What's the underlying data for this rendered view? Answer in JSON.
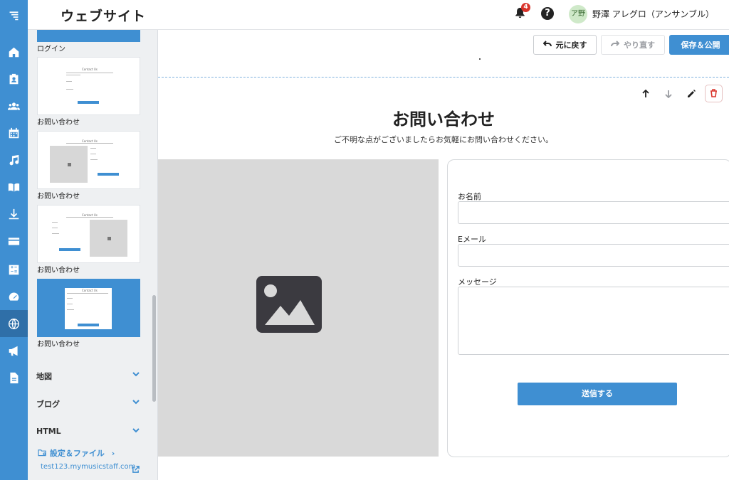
{
  "header": {
    "title": "ウェブサイト",
    "notification_count": "4",
    "help_label": "?",
    "user_initials": "ア野",
    "user_name": "野澤 アレグロ（アンサンブル）"
  },
  "rail": {
    "items": [
      {
        "icon": "logo-icon"
      },
      {
        "icon": "home-icon"
      },
      {
        "icon": "contact-card-icon"
      },
      {
        "icon": "people-icon"
      },
      {
        "icon": "calendar-icon"
      },
      {
        "icon": "music-note-icon"
      },
      {
        "icon": "book-icon"
      },
      {
        "icon": "download-icon"
      },
      {
        "icon": "credit-card-icon"
      },
      {
        "icon": "calculator-icon"
      },
      {
        "icon": "dashboard-icon"
      },
      {
        "icon": "globe-icon",
        "active": true
      },
      {
        "icon": "megaphone-icon"
      },
      {
        "icon": "document-icon"
      }
    ]
  },
  "sidebar": {
    "top_label": "ログイン",
    "thumbnails": [
      {
        "title": "Contact Us",
        "label": "お問い合わせ"
      },
      {
        "title": "Contact Us",
        "label": "お問い合わせ"
      },
      {
        "title": "Contact Us",
        "label": "お問い合わせ"
      },
      {
        "title": "Contact Us",
        "label": "お問い合わせ"
      }
    ],
    "categories": [
      "地図",
      "ブログ",
      "HTML"
    ],
    "settings_label": "設定＆ファイル",
    "site_url": "test123.mymusicstaff.com"
  },
  "toolbar": {
    "undo_label": "元に戻す",
    "redo_label": "やり直す",
    "save_label": "保存＆公開"
  },
  "section": {
    "heading": "お問い合わせ",
    "subheading": "ご不明な点がございましたらお気軽にお問い合わせください。",
    "form": {
      "name_label": "お名前",
      "email_label": "Eメール",
      "message_label": "メッセージ",
      "submit_label": "送信する"
    }
  },
  "colors": {
    "accent": "#3f8fd2",
    "rail_active": "#2f6fa8",
    "delete": "#d9342b"
  }
}
